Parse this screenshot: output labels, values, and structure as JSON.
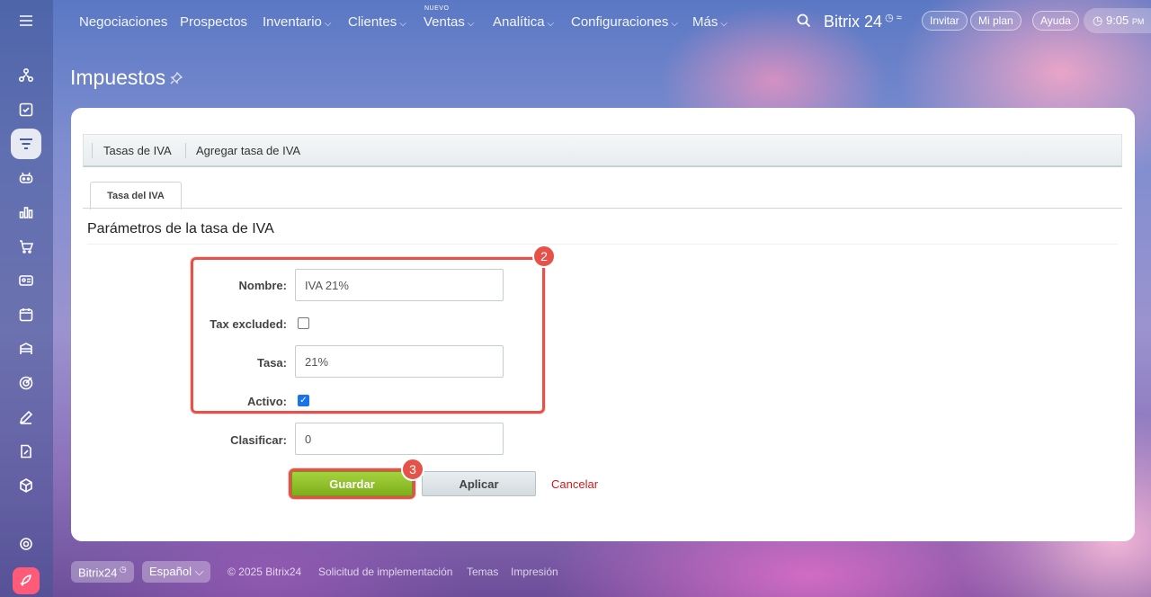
{
  "topnav": {
    "items": [
      {
        "label": "Negociaciones"
      },
      {
        "label": "Prospectos"
      },
      {
        "label": "Inventario",
        "chevron": "⌵"
      },
      {
        "label": "Clientes",
        "chevron": "⌵"
      },
      {
        "label": "Ventas",
        "chevron": "⌵",
        "tag": "NUEVO"
      },
      {
        "label": "Analítica",
        "chevron": "⌵"
      },
      {
        "label": "Configuraciones",
        "chevron": "⌵"
      },
      {
        "label": "Más",
        "chevron": "⌵"
      }
    ],
    "brand": "Bitrix 24",
    "invite": "Invitar",
    "my_plan": "Mi plan",
    "help": "Ayuda",
    "time": "9:05",
    "ampm": "PM"
  },
  "page": {
    "title": "Impuestos"
  },
  "toolbar": {
    "item_rates": "Tasas de IVA",
    "item_add": "Agregar tasa de IVA"
  },
  "tab": {
    "label": "Tasa del IVA"
  },
  "form": {
    "section_title": "Parámetros de la tasa de IVA",
    "name_label": "Nombre:",
    "name_value": "IVA 21%",
    "tax_excluded_label": "Tax excluded:",
    "tax_excluded_checked": false,
    "rate_label": "Tasa:",
    "rate_value": "21%",
    "active_label": "Activo:",
    "active_checked": true,
    "sort_label": "Clasificar:",
    "sort_value": "0"
  },
  "buttons": {
    "save": "Guardar",
    "apply": "Aplicar",
    "cancel": "Cancelar"
  },
  "annotations": {
    "badge_2": "2",
    "badge_3": "3",
    "color": "#e5524a"
  },
  "footer": {
    "brand": "Bitrix24",
    "language": "Español",
    "copyright": "© 2025 Bitrix24",
    "implementation": "Solicitud de implementación",
    "themes": "Temas",
    "print": "Impresión"
  },
  "colors": {
    "save_green": "#8fc12a",
    "cancel_red": "#d0191b",
    "checkbox_blue": "#1a73e8"
  }
}
